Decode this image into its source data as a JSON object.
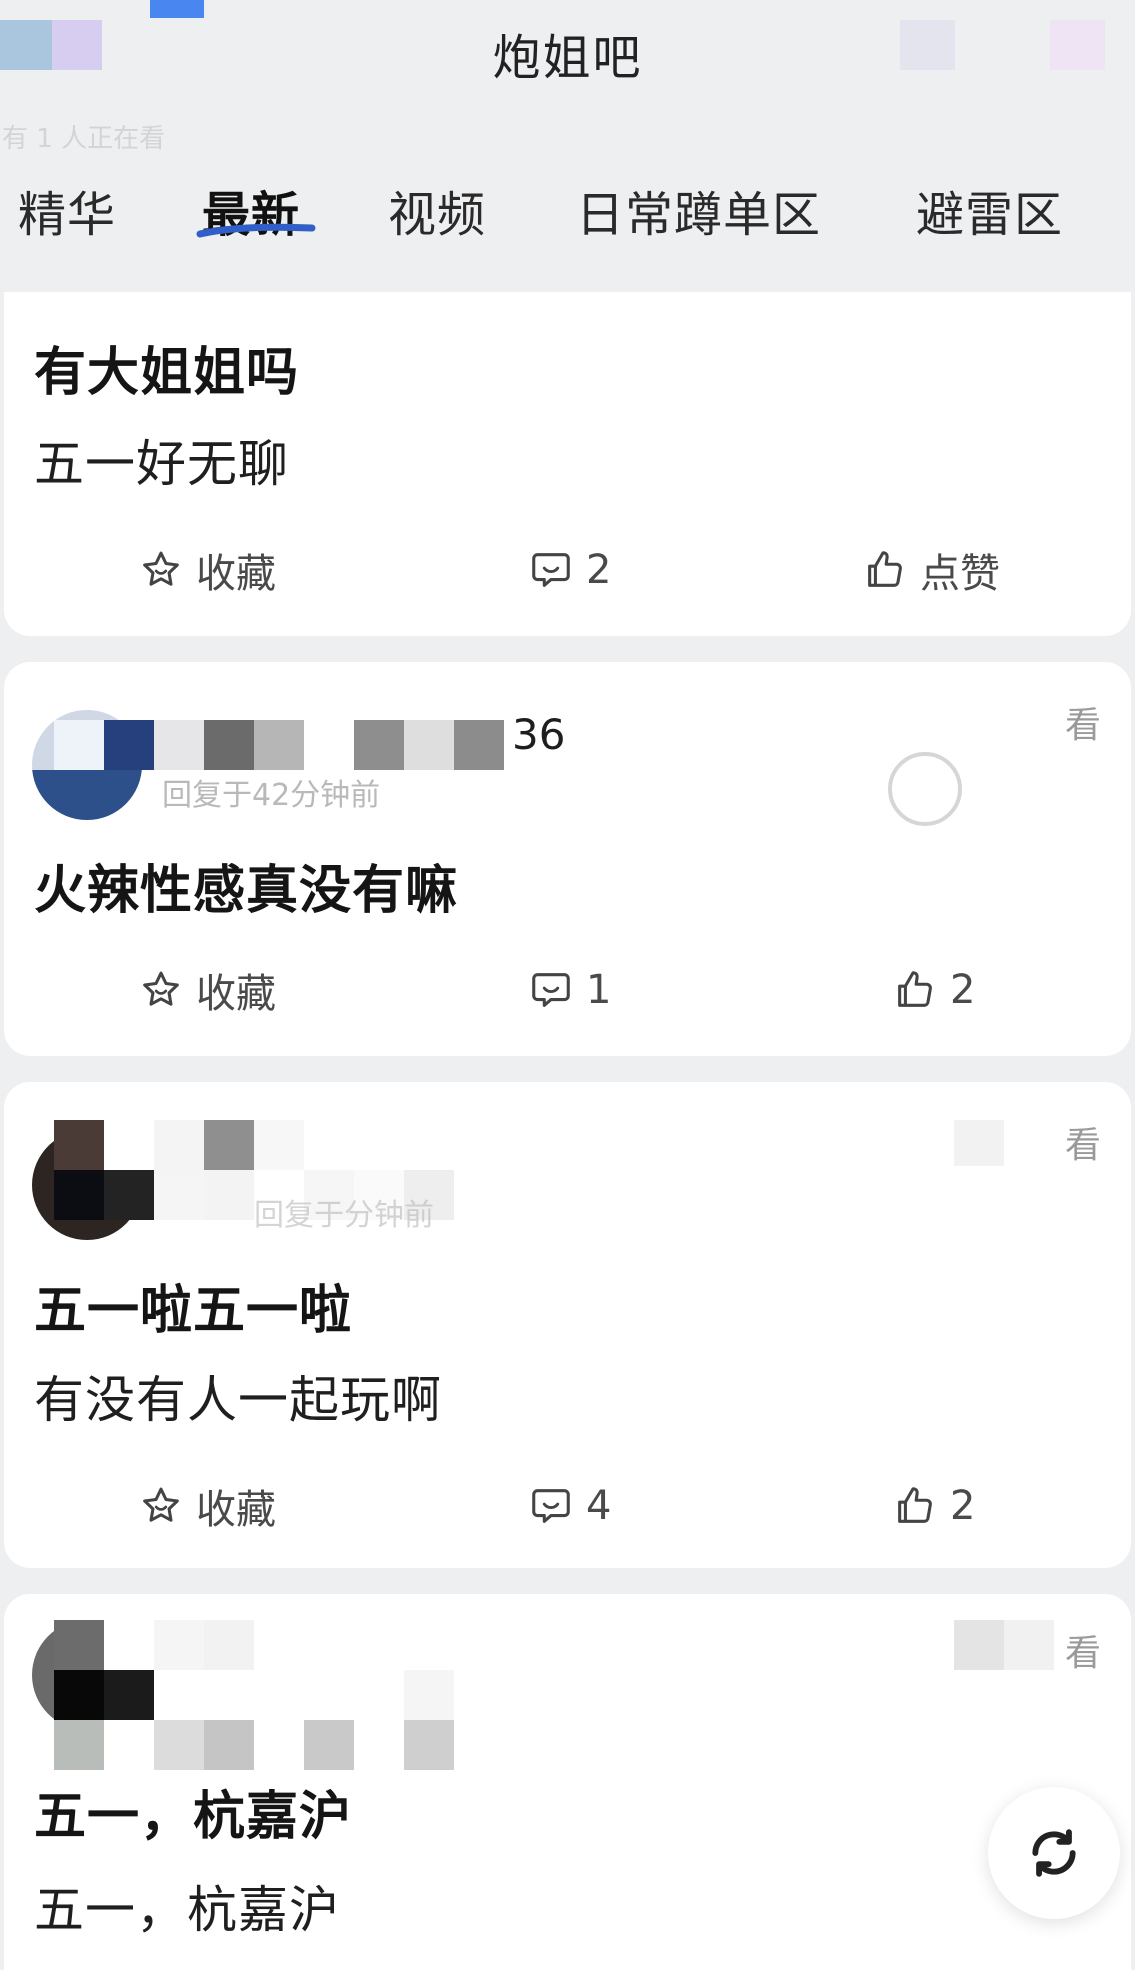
{
  "header": {
    "title": "炮姐吧",
    "online_text": "有 1 人正在看"
  },
  "tabs": [
    {
      "label": "精华"
    },
    {
      "label": "最新"
    },
    {
      "label": "视频"
    },
    {
      "label": "日常蹲单区"
    },
    {
      "label": "避雷区"
    }
  ],
  "active_tab": "最新",
  "posts": [
    {
      "title": "有大姐姐吗",
      "body": "五一好无聊",
      "actions": {
        "favorite": "收藏",
        "comments": "2",
        "like": "点赞"
      }
    },
    {
      "username_suffix": "36",
      "meta": "回复于42分钟前",
      "view_label": "看",
      "title": "火辣性感真没有嘛",
      "actions": {
        "favorite": "收藏",
        "comments": "1",
        "like": "2"
      }
    },
    {
      "meta": "回复于分钟前",
      "view_label": "看",
      "title": "五一啦五一啦",
      "body": "有没有人一起玩啊",
      "actions": {
        "favorite": "收藏",
        "comments": "4",
        "like": "2"
      }
    },
    {
      "view_label": "看",
      "title": "五一，杭嘉沪",
      "body": "五一，杭嘉沪"
    }
  ],
  "colors": {
    "background": "#eeeff1",
    "card": "#ffffff",
    "active_underline": "#2f5fc7",
    "muted_text": "#b9b9b9"
  },
  "icons": [
    "star-icon",
    "comment-icon",
    "thumbs-up-icon",
    "refresh-icon"
  ]
}
